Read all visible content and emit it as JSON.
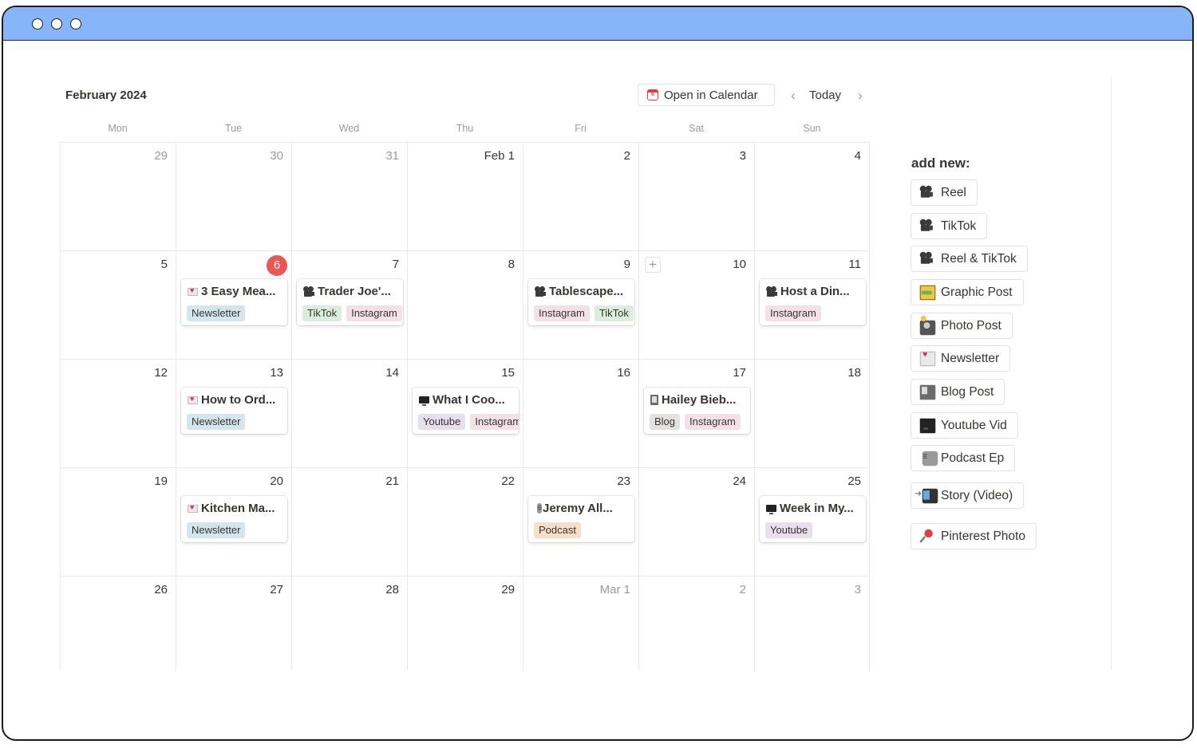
{
  "header": {
    "month": "February 2024",
    "open_in_calendar": "Open in Calendar",
    "open_in_calendar_icon_day": "6",
    "today": "Today",
    "prev": "‹",
    "next": "›"
  },
  "weekdays": [
    "Mon",
    "Tue",
    "Wed",
    "Thu",
    "Fri",
    "Sat",
    "Sun"
  ],
  "weeks": [
    [
      {
        "label": "29",
        "muted": true
      },
      {
        "label": "30",
        "muted": true
      },
      {
        "label": "31",
        "muted": true
      },
      {
        "label": "Feb 1"
      },
      {
        "label": "2"
      },
      {
        "label": "3"
      },
      {
        "label": "4"
      }
    ],
    [
      {
        "label": "5"
      },
      {
        "label": "6",
        "today": true,
        "card": {
          "icon": "news",
          "title": "3 Easy Mea...",
          "tags": [
            {
              "name": "Newsletter",
              "kind": "newsletter"
            }
          ]
        }
      },
      {
        "label": "7",
        "card": {
          "icon": "reel",
          "title": "Trader Joe'...",
          "tags": [
            {
              "name": "TikTok",
              "kind": "tiktok"
            },
            {
              "name": "Instagram",
              "kind": "instagram"
            }
          ]
        }
      },
      {
        "label": "8"
      },
      {
        "label": "9",
        "card": {
          "icon": "reel",
          "title": "Tablescape...",
          "tags": [
            {
              "name": "Instagram",
              "kind": "instagram"
            },
            {
              "name": "TikTok",
              "kind": "tiktok"
            }
          ]
        }
      },
      {
        "label": "10",
        "add": true,
        "add_label": "+"
      },
      {
        "label": "11",
        "card": {
          "icon": "reel",
          "title": "Host a Din...",
          "tags": [
            {
              "name": "Instagram",
              "kind": "instagram"
            }
          ]
        }
      }
    ],
    [
      {
        "label": "12"
      },
      {
        "label": "13",
        "card": {
          "icon": "news",
          "title": "How to Ord...",
          "tags": [
            {
              "name": "Newsletter",
              "kind": "newsletter"
            }
          ]
        }
      },
      {
        "label": "14"
      },
      {
        "label": "15",
        "card": {
          "icon": "monitor",
          "title": "What I Coo...",
          "tags": [
            {
              "name": "Youtube",
              "kind": "youtube"
            },
            {
              "name": "Instagram",
              "kind": "instagram"
            }
          ]
        }
      },
      {
        "label": "16"
      },
      {
        "label": "17",
        "card": {
          "icon": "book",
          "title": "Hailey Bieb...",
          "tags": [
            {
              "name": "Blog",
              "kind": "blog"
            },
            {
              "name": "Instagram",
              "kind": "instagram"
            }
          ]
        }
      },
      {
        "label": "18"
      }
    ],
    [
      {
        "label": "19"
      },
      {
        "label": "20",
        "card": {
          "icon": "news",
          "title": "Kitchen Ma...",
          "tags": [
            {
              "name": "Newsletter",
              "kind": "newsletter"
            }
          ]
        }
      },
      {
        "label": "21"
      },
      {
        "label": "22"
      },
      {
        "label": "23",
        "card": {
          "icon": "mic",
          "title": "Jeremy All...",
          "tags": [
            {
              "name": "Podcast",
              "kind": "podcast"
            }
          ]
        }
      },
      {
        "label": "24"
      },
      {
        "label": "25",
        "card": {
          "icon": "monitor",
          "title": "Week in My...",
          "tags": [
            {
              "name": "Youtube",
              "kind": "youtube"
            }
          ]
        }
      }
    ],
    [
      {
        "label": "26"
      },
      {
        "label": "27"
      },
      {
        "label": "28"
      },
      {
        "label": "29"
      },
      {
        "label": "Mar 1",
        "muted": true
      },
      {
        "label": "2",
        "muted": true
      },
      {
        "label": "3",
        "muted": true
      }
    ]
  ],
  "sidebar": {
    "title": "add new:",
    "templates": [
      {
        "label": "Reel",
        "icon": "reel"
      },
      {
        "label": "TikTok",
        "icon": "reel"
      },
      {
        "label": "Reel & TikTok",
        "icon": "reel"
      },
      {
        "label": "Graphic Post",
        "icon": "picture"
      },
      {
        "label": "Photo Post",
        "icon": "camera"
      },
      {
        "label": "Newsletter",
        "icon": "news"
      },
      {
        "label": "Blog Post",
        "icon": "book"
      },
      {
        "label": "Youtube Vid",
        "icon": "monitor"
      },
      {
        "label": "Podcast Ep",
        "icon": "mic"
      },
      {
        "label": "Story (Video)",
        "icon": "phone"
      },
      {
        "label": "Pinterest Photo",
        "icon": "pin"
      }
    ]
  },
  "colors": {
    "titlebar": "#86b5fa",
    "today_badge": "#eb5757",
    "newsletter_tag": "#d3e5ef",
    "tiktok_tag": "#dbeddb",
    "instagram_tag": "#f5e0e9",
    "youtube_tag": "#e8deee",
    "blog_tag": "#e3e2e0",
    "podcast_tag": "#fadec9"
  }
}
